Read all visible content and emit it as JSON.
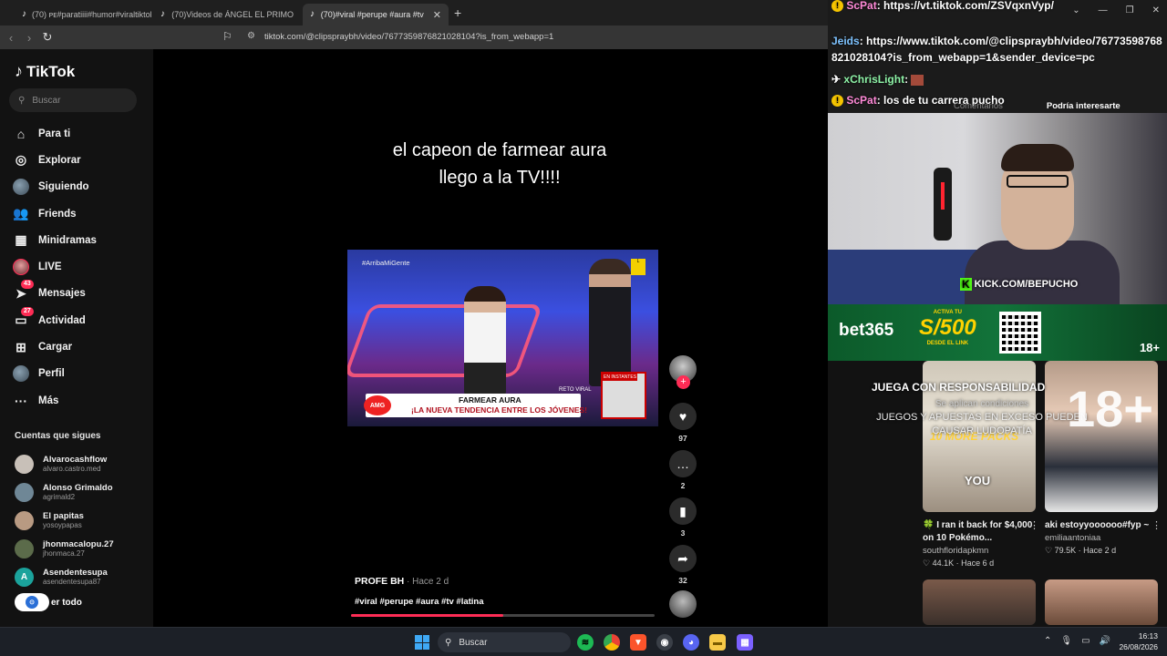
{
  "browser": {
    "tabs": [
      {
        "label": "(70) ᴘᴇ#paratiiii#humor#viraltiktok",
        "active": false
      },
      {
        "label": "(70)Videos de ÁNGEL EL PRIMO",
        "active": false
      },
      {
        "label": "(70)#viral #perupe #aura #tv",
        "active": true
      }
    ],
    "url": "tiktok.com/@clipspraybh/video/7677359876821028104?is_from_webapp=1"
  },
  "tiktok": {
    "logo": "TikTok",
    "search_placeholder": "Buscar",
    "nav": [
      {
        "label": "Para ti",
        "icon": "home-icon"
      },
      {
        "label": "Explorar",
        "icon": "compass-icon"
      },
      {
        "label": "Siguiendo",
        "icon": "avatar-icon"
      },
      {
        "label": "Friends",
        "icon": "friends-icon"
      },
      {
        "label": "Minidramas",
        "icon": "film-icon"
      },
      {
        "label": "LIVE",
        "icon": "live-icon"
      },
      {
        "label": "Mensajes",
        "icon": "message-icon",
        "badge": "43"
      },
      {
        "label": "Actividad",
        "icon": "activity-icon",
        "badge": "27"
      },
      {
        "label": "Cargar",
        "icon": "upload-icon"
      },
      {
        "label": "Perfil",
        "icon": "profile-icon"
      },
      {
        "label": "Más",
        "icon": "more-icon"
      }
    ],
    "following_header": "Cuentas que sigues",
    "following": [
      {
        "name": "Alvarocashflow",
        "user": "alvaro.castro.med"
      },
      {
        "name": "Alonso Grimaldo",
        "user": "agrimald2"
      },
      {
        "name": "El papitas",
        "user": "yosoypapas"
      },
      {
        "name": "jhonmacalopu.27",
        "user": "jhonmaca.27"
      },
      {
        "name": "Asendentesupa",
        "user": "asendentesupa87",
        "initial": "A"
      }
    ],
    "see_all": "er todo",
    "video": {
      "caption_line1": "el capeon de farmear aura",
      "caption_line2": "llego a la TV!!!!",
      "overlay_hashtag": "#ArribaMiGente",
      "lower_third_title": "FARMEAR AURA",
      "lower_third_sub": "¡LA NUEVA TENDENCIA ENTRE LOS JÓVENES!",
      "badge_amg": "AMG",
      "inset_label": "EN INSTANTES",
      "reto": "RETO VIRAL",
      "author": "PROFE BH",
      "time": " · Hace 2 d",
      "tags": "#viral #perupe #aura #tv #latina",
      "progress": 0.5
    },
    "actions": {
      "likes": "97",
      "comments": "2",
      "saves": "3",
      "shares": "32"
    }
  },
  "overlay": {
    "chat": [
      {
        "user": "ScPat",
        "text": "https://vt.tiktok.com/ZSVqxnVyp/"
      },
      {
        "user": "Jeids",
        "text": "https://www.tiktok.com/@clipspraybh/video/76773598768"
      },
      {
        "user": "",
        "text": "821028104?is_from_webapp=1&sender_device=pc"
      },
      {
        "user": "xChrisLight",
        "text": ""
      },
      {
        "user": "ScPat",
        "text": "los de tu carrera pucho"
      }
    ],
    "tab_comments": "Comentarios",
    "tab_interest": "Podría interesarte",
    "kick": "KICK.COM/BEPUCHO",
    "bet": "bet365",
    "promo_amount": "S/500",
    "promo_top": "ACTIVA TU",
    "promo_bottom": "DESDE EL LINK",
    "age": "18+",
    "responsible": "JUEGA CON RESPONSABILIDAD",
    "conditions": "Se aplican condiciones",
    "warning": "JUEGOS Y APUESTAS EN EXCESO PUEDEN CAUSAR LUDOPATÍA",
    "big_age": "18+"
  },
  "recommendations": [
    {
      "title": "🍀 I ran it back for $4,000 on 10 Pokémo...",
      "user": "southfloridapkmn",
      "stats": "♡ 44.1K · Hace 6 d",
      "overlay": "10 MORE PACKS",
      "you": "YOU"
    },
    {
      "title": "aki estoyyoooooo#fyp ~",
      "user": "emiliaantoniaa",
      "stats": "♡ 79.5K · Hace 2 d"
    }
  ],
  "taskbar": {
    "search": "Buscar",
    "time": "16:13",
    "date": "26/08/2026"
  }
}
